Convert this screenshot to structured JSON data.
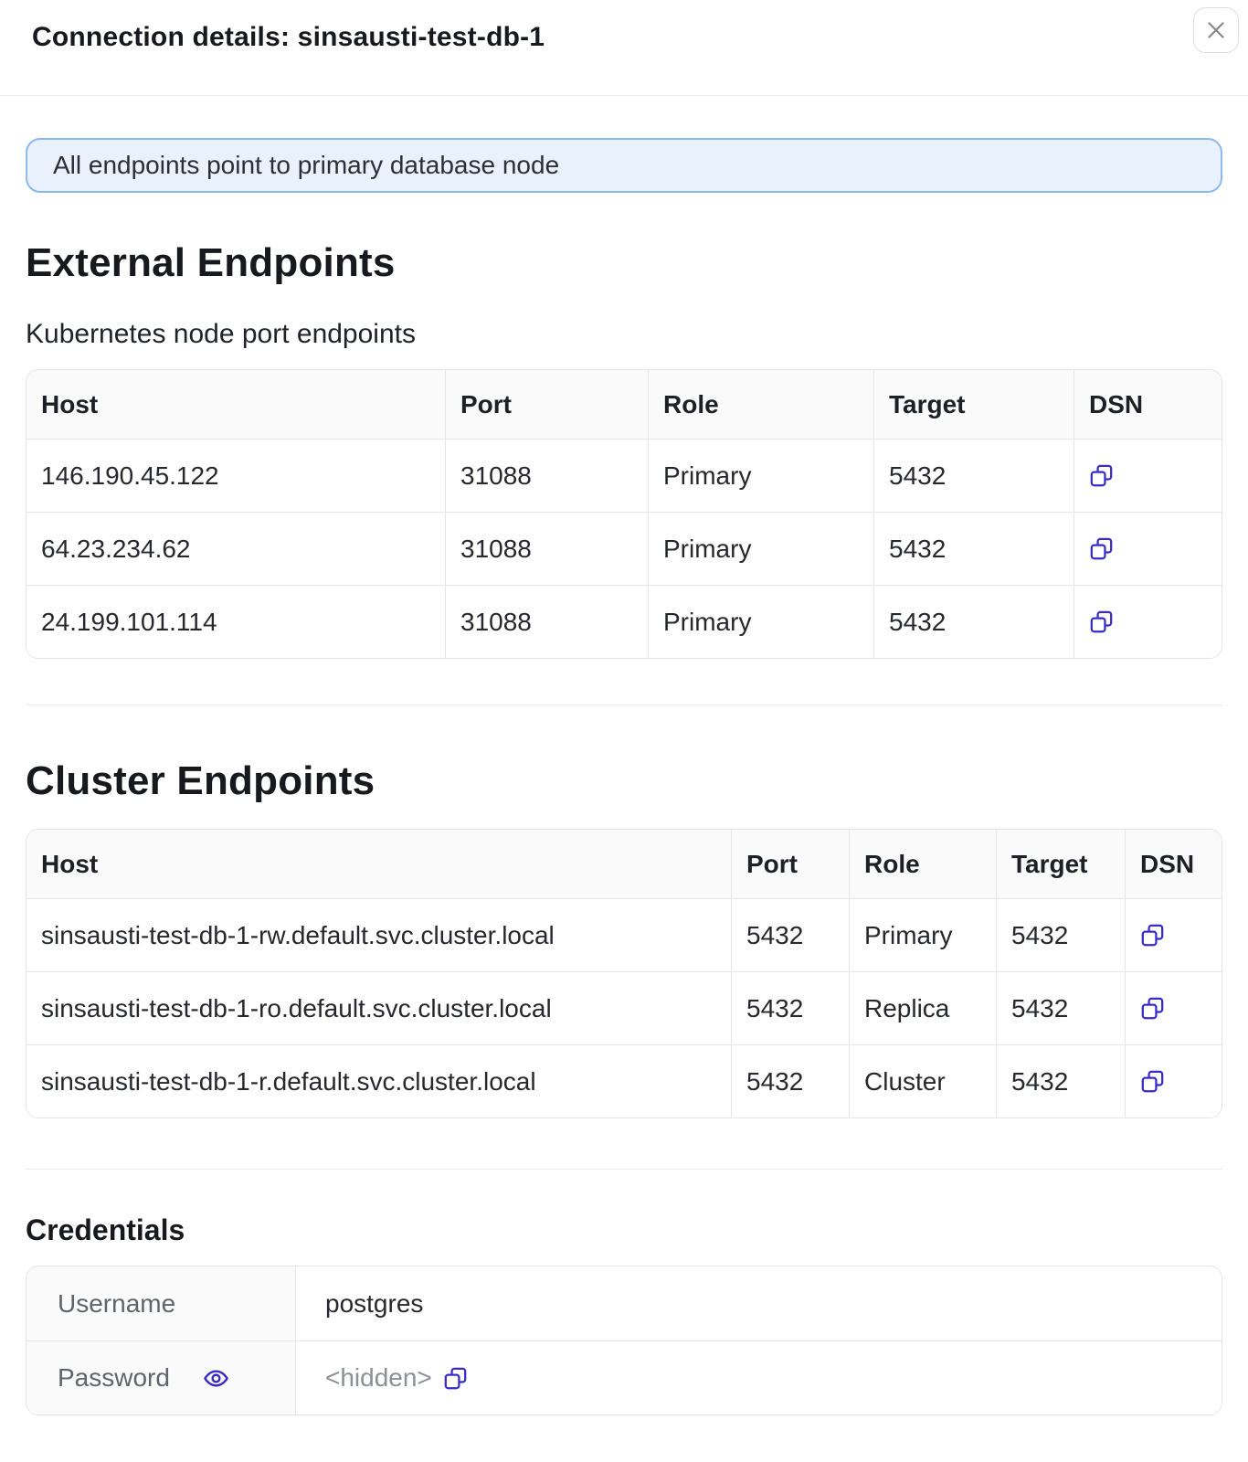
{
  "modal": {
    "title": "Connection details: sinsausti-test-db-1"
  },
  "banner": {
    "text": "All endpoints point to primary database node"
  },
  "external_endpoints": {
    "title": "External Endpoints",
    "subtitle": "Kubernetes node port endpoints",
    "columns": [
      "Host",
      "Port",
      "Role",
      "Target",
      "DSN"
    ],
    "rows": [
      {
        "host": "146.190.45.122",
        "port": "31088",
        "role": "Primary",
        "target": "5432",
        "dsn_icon": "copy-icon"
      },
      {
        "host": "64.23.234.62",
        "port": "31088",
        "role": "Primary",
        "target": "5432",
        "dsn_icon": "copy-icon"
      },
      {
        "host": "24.199.101.114",
        "port": "31088",
        "role": "Primary",
        "target": "5432",
        "dsn_icon": "copy-icon"
      }
    ]
  },
  "cluster_endpoints": {
    "title": "Cluster Endpoints",
    "columns": [
      "Host",
      "Port",
      "Role",
      "Target",
      "DSN"
    ],
    "rows": [
      {
        "host": "sinsausti-test-db-1-rw.default.svc.cluster.local",
        "port": "5432",
        "role": "Primary",
        "target": "5432",
        "dsn_icon": "copy-icon"
      },
      {
        "host": "sinsausti-test-db-1-ro.default.svc.cluster.local",
        "port": "5432",
        "role": "Replica",
        "target": "5432",
        "dsn_icon": "copy-icon"
      },
      {
        "host": "sinsausti-test-db-1-r.default.svc.cluster.local",
        "port": "5432",
        "role": "Cluster",
        "target": "5432",
        "dsn_icon": "copy-icon"
      }
    ]
  },
  "credentials": {
    "title": "Credentials",
    "username_label": "Username",
    "username_value": "postgres",
    "password_label": "Password",
    "password_value": "<hidden>"
  },
  "icons": {
    "close": "close-icon",
    "copy": "copy-icon",
    "eye": "eye-icon"
  },
  "colors": {
    "accent": "#3a2bc8",
    "banner_bg": "#e9f1fc",
    "banner_border": "#8cb8ee"
  }
}
